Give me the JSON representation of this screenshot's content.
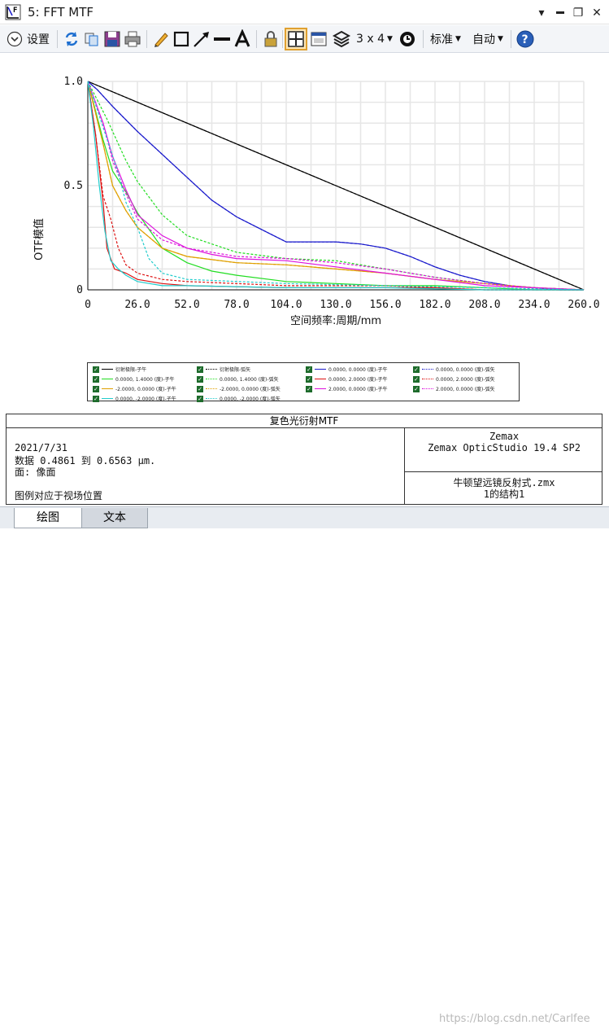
{
  "window": {
    "title": "5: FFT MTF",
    "minimize_glyph": "▬",
    "restore_glyph": "❐",
    "close_glyph": "✕",
    "pin_glyph": "▾"
  },
  "toolbar": {
    "settings_label": "设置",
    "layout_label": "3 x 4",
    "standard_label": "标准",
    "auto_label": "自动",
    "icons": [
      "settings-chevron-icon",
      "refresh-icon",
      "copy-icon",
      "save-icon",
      "print-icon",
      "pencil-icon",
      "rectangle-icon",
      "arrow-line-icon",
      "line-icon",
      "text-icon",
      "lock-icon",
      "fit-layout-icon",
      "window-icon",
      "stack-icon",
      "clock-icon",
      "help-icon"
    ]
  },
  "chart_data": {
    "type": "line",
    "ylabel": "OTF模值",
    "xlabel": "空间频率:周期/mm",
    "xlim": [
      0,
      260
    ],
    "ylim": [
      0,
      1
    ],
    "x_ticks": [
      "0",
      "26.0",
      "52.0",
      "78.0",
      "104.0",
      "130.0",
      "156.0",
      "182.0",
      "208.0",
      "234.0",
      "260.0"
    ],
    "y_ticks": [
      "0",
      "0.5",
      "1.0"
    ],
    "grid": true,
    "series": [
      {
        "name": "衍射极限-子午",
        "color": "#000000",
        "dash": false,
        "x": [
          0,
          26,
          52,
          78,
          104,
          130,
          156,
          182,
          208,
          234,
          260
        ],
        "y": [
          1.0,
          0.9,
          0.8,
          0.7,
          0.6,
          0.5,
          0.4,
          0.3,
          0.2,
          0.1,
          0.0
        ]
      },
      {
        "name": "衍射极限-弧矢",
        "color": "#000000",
        "dash": true,
        "x": [
          0,
          26,
          52,
          78,
          104,
          130,
          156,
          182,
          208,
          234,
          260
        ],
        "y": [
          1.0,
          0.9,
          0.8,
          0.7,
          0.6,
          0.5,
          0.4,
          0.3,
          0.2,
          0.1,
          0.0
        ]
      },
      {
        "name": "0.0000, 0.0000 (度)-子午",
        "color": "#1a1acc",
        "dash": false,
        "x": [
          0,
          5,
          13,
          26,
          39,
          52,
          65,
          78,
          91,
          104,
          117,
          130,
          143,
          156,
          169,
          182,
          195,
          208,
          221,
          234,
          247,
          260
        ],
        "y": [
          1.0,
          0.96,
          0.88,
          0.76,
          0.65,
          0.54,
          0.43,
          0.35,
          0.29,
          0.23,
          0.23,
          0.23,
          0.22,
          0.2,
          0.16,
          0.11,
          0.07,
          0.04,
          0.02,
          0.01,
          0.0,
          0.0
        ]
      },
      {
        "name": "0.0000, 0.0000 (度)-弧矢",
        "color": "#1a1acc",
        "dash": true,
        "x": [
          0,
          5,
          13,
          26,
          39,
          52,
          65,
          78,
          91,
          104,
          117,
          130,
          143,
          156,
          169,
          182,
          195,
          208,
          221,
          234,
          247,
          260
        ],
        "y": [
          1.0,
          0.96,
          0.88,
          0.76,
          0.65,
          0.54,
          0.43,
          0.35,
          0.29,
          0.23,
          0.23,
          0.23,
          0.22,
          0.2,
          0.16,
          0.11,
          0.07,
          0.04,
          0.02,
          0.01,
          0.0,
          0.0
        ]
      },
      {
        "name": "0.0000, 1.4000 (度)-子午",
        "color": "#22dd22",
        "dash": false,
        "x": [
          0,
          4,
          8,
          13,
          20,
          26,
          39,
          52,
          65,
          78,
          104,
          130,
          156,
          182,
          208,
          234,
          260
        ],
        "y": [
          1.0,
          0.86,
          0.72,
          0.57,
          0.47,
          0.37,
          0.2,
          0.13,
          0.09,
          0.07,
          0.04,
          0.03,
          0.02,
          0.02,
          0.01,
          0.0,
          0.0
        ]
      },
      {
        "name": "0.0000, 1.4000 (度)-弧矢",
        "color": "#22dd22",
        "dash": true,
        "x": [
          0,
          10,
          20,
          26,
          39,
          52,
          78,
          104,
          130,
          156,
          182,
          208,
          234,
          260
        ],
        "y": [
          1.0,
          0.82,
          0.62,
          0.52,
          0.36,
          0.26,
          0.18,
          0.15,
          0.14,
          0.1,
          0.06,
          0.03,
          0.01,
          0.0
        ]
      },
      {
        "name": "0.0000, 2.0000 (度)-子午",
        "color": "#dd1111",
        "dash": false,
        "x": [
          0,
          4,
          8,
          10,
          14,
          20,
          26,
          39,
          52,
          78,
          104,
          130,
          156,
          182,
          208,
          234,
          260
        ],
        "y": [
          1.0,
          0.75,
          0.42,
          0.2,
          0.1,
          0.08,
          0.05,
          0.03,
          0.02,
          0.015,
          0.01,
          0.01,
          0.01,
          0.01,
          0.0,
          0.0,
          0.0
        ]
      },
      {
        "name": "0.0000, 2.0000 (度)-弧矢",
        "color": "#dd1111",
        "dash": true,
        "x": [
          0,
          4,
          8,
          12,
          16,
          20,
          26,
          39,
          52,
          78,
          104,
          130,
          156,
          182,
          208,
          234,
          260
        ],
        "y": [
          1.0,
          0.75,
          0.45,
          0.34,
          0.2,
          0.12,
          0.08,
          0.05,
          0.04,
          0.03,
          0.02,
          0.02,
          0.02,
          0.01,
          0.0,
          0.0,
          0.0
        ]
      },
      {
        "name": "-2.0000, 0.0000 (度)-子午",
        "color": "#e0a000",
        "dash": false,
        "x": [
          0,
          8,
          13,
          20,
          26,
          39,
          52,
          78,
          104,
          130,
          156,
          182,
          208,
          234,
          260
        ],
        "y": [
          1.0,
          0.7,
          0.5,
          0.38,
          0.3,
          0.2,
          0.16,
          0.13,
          0.12,
          0.1,
          0.08,
          0.05,
          0.03,
          0.01,
          0.0
        ]
      },
      {
        "name": "-2.0000, 0.0000 (度)-弧矢",
        "color": "#e0a000",
        "dash": true,
        "x": [
          0,
          8,
          13,
          20,
          26,
          39,
          52,
          78,
          104,
          130,
          156,
          182,
          208,
          234,
          260
        ],
        "y": [
          1.0,
          0.7,
          0.5,
          0.38,
          0.3,
          0.2,
          0.16,
          0.13,
          0.12,
          0.1,
          0.08,
          0.05,
          0.03,
          0.01,
          0.0
        ]
      },
      {
        "name": "2.0000, 0.0000 (度)-子午",
        "color": "#dd11dd",
        "dash": false,
        "x": [
          0,
          8,
          13,
          20,
          26,
          39,
          52,
          65,
          78,
          104,
          130,
          156,
          182,
          208,
          234,
          260
        ],
        "y": [
          1.0,
          0.8,
          0.64,
          0.48,
          0.36,
          0.26,
          0.2,
          0.17,
          0.15,
          0.14,
          0.11,
          0.08,
          0.05,
          0.02,
          0.01,
          0.0
        ]
      },
      {
        "name": "2.0000, 0.0000 (度)-弧矢",
        "color": "#dd11dd",
        "dash": true,
        "x": [
          0,
          8,
          13,
          20,
          26,
          39,
          52,
          65,
          78,
          104,
          130,
          156,
          182,
          208,
          234,
          260
        ],
        "y": [
          1.0,
          0.8,
          0.62,
          0.46,
          0.34,
          0.24,
          0.2,
          0.18,
          0.16,
          0.15,
          0.13,
          0.1,
          0.06,
          0.03,
          0.01,
          0.0
        ]
      },
      {
        "name": "0.0000, -2.0000 (度)-子午",
        "color": "#22cccc",
        "dash": false,
        "x": [
          0,
          3,
          6,
          9,
          12,
          16,
          20,
          26,
          39,
          52,
          104,
          156,
          208,
          260
        ],
        "y": [
          1.0,
          0.78,
          0.5,
          0.28,
          0.14,
          0.1,
          0.07,
          0.04,
          0.02,
          0.02,
          0.01,
          0.01,
          0.0,
          0.0
        ]
      },
      {
        "name": "0.0000, -2.0000 (度)-弧矢",
        "color": "#22cccc",
        "dash": true,
        "x": [
          0,
          8,
          16,
          20,
          26,
          32,
          39,
          52,
          104,
          156,
          208,
          260
        ],
        "y": [
          1.0,
          0.78,
          0.56,
          0.42,
          0.3,
          0.15,
          0.08,
          0.05,
          0.03,
          0.02,
          0.01,
          0.0
        ]
      }
    ]
  },
  "legend": [
    "衍射极限-子午",
    "衍射极限-弧矢",
    "0.0000, 0.0000 (度)-子午",
    "0.0000, 0.0000 (度)-弧矢",
    "0.0000, 1.4000 (度)-子午",
    "0.0000, 1.4000 (度)-弧矢",
    "0.0000, 2.0000 (度)-子午",
    "0.0000, 2.0000 (度)-弧矢",
    "-2.0000, 0.0000 (度)-子午",
    "-2.0000, 0.0000 (度)-弧矢",
    "2.0000, 0.0000 (度)-子午",
    "2.0000, 0.0000 (度)-弧矢",
    "0.0000, -2.0000 (度)-子午",
    "0.0000, -2.0000 (度)-弧矢"
  ],
  "info": {
    "title": "复色光衍射MTF",
    "date": "2021/7/31",
    "data_range": "数据 0.4861 到 0.6563 μm.",
    "surface": "面: 像面",
    "note": "图例对应于视场位置",
    "company": "Zemax",
    "product": "Zemax OpticStudio 19.4 SP2",
    "file": "牛顿望远镜反射式.zmx",
    "config": "1的结构1"
  },
  "tabs": [
    "绘图",
    "文本"
  ],
  "watermark": "https://blog.csdn.net/Carlfee"
}
